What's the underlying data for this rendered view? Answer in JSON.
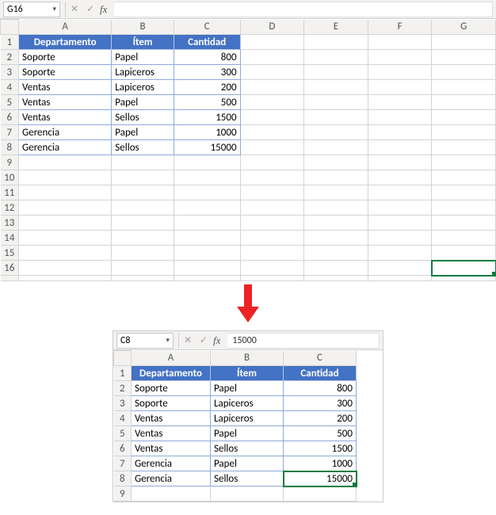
{
  "top": {
    "name_box": "G16",
    "formula": "",
    "columns": [
      "A",
      "B",
      "C",
      "D",
      "E",
      "F",
      "G"
    ],
    "row_numbers": [
      1,
      2,
      3,
      4,
      5,
      6,
      7,
      8,
      9,
      10,
      11,
      12,
      13,
      14,
      15,
      16
    ],
    "headers": {
      "a": "Departamento",
      "b": "Ítem",
      "c": "Cantidad"
    },
    "rows": [
      {
        "a": "Soporte",
        "b": "Papel",
        "c": "800"
      },
      {
        "a": "Soporte",
        "b": "Lapiceros",
        "c": "300"
      },
      {
        "a": "Ventas",
        "b": "Lapiceros",
        "c": "200"
      },
      {
        "a": "Ventas",
        "b": "Papel",
        "c": "500"
      },
      {
        "a": "Ventas",
        "b": "Sellos",
        "c": "1500"
      },
      {
        "a": "Gerencia",
        "b": "Papel",
        "c": "1000"
      },
      {
        "a": "Gerencia",
        "b": "Sellos",
        "c": "15000"
      }
    ],
    "selected": "G16"
  },
  "bottom": {
    "name_box": "C8",
    "formula": "15000",
    "columns": [
      "A",
      "B",
      "C"
    ],
    "row_numbers": [
      1,
      2,
      3,
      4,
      5,
      6,
      7,
      8,
      9
    ],
    "headers": {
      "a": "Departamento",
      "b": "Ítem",
      "c": "Cantidad"
    },
    "rows": [
      {
        "a": "Soporte",
        "b": "Papel",
        "c": "800"
      },
      {
        "a": "Soporte",
        "b": "Lapiceros",
        "c": "300"
      },
      {
        "a": "Ventas",
        "b": "Lapiceros",
        "c": "200"
      },
      {
        "a": "Ventas",
        "b": "Papel",
        "c": "500"
      },
      {
        "a": "Ventas",
        "b": "Sellos",
        "c": "1500"
      },
      {
        "a": "Gerencia",
        "b": "Papel",
        "c": "1000"
      },
      {
        "a": "Gerencia",
        "b": "Sellos",
        "c": "15000"
      }
    ],
    "selected": "C8"
  },
  "fx_label": "fx"
}
